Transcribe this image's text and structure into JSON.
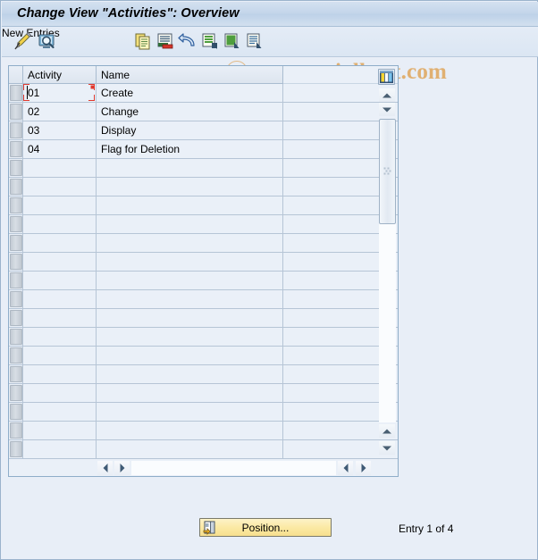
{
  "window": {
    "title": "Change View \"Activities\": Overview"
  },
  "toolbar": {
    "new_entries_label": "New Entries",
    "icons": [
      {
        "name": "change-pencil-icon",
        "title": "Change"
      },
      {
        "name": "display-magnifier-icon",
        "title": "Display"
      },
      {
        "name": "copy-as-icon",
        "title": "Copy As..."
      },
      {
        "name": "delete-entry-icon",
        "title": "Delete"
      },
      {
        "name": "undo-change-icon",
        "title": "Undo Change"
      },
      {
        "name": "select-all-icon",
        "title": "Select All"
      },
      {
        "name": "deselect-all-icon",
        "title": "Deselect All"
      },
      {
        "name": "details-icon",
        "title": "Details"
      }
    ]
  },
  "watermark": {
    "text": "www.tutorialkart.com"
  },
  "table": {
    "columns": [
      {
        "key": "activity",
        "label": "Activity"
      },
      {
        "key": "name",
        "label": "Name"
      }
    ],
    "rows": [
      {
        "activity": "01",
        "name": "Create"
      },
      {
        "activity": "02",
        "name": "Change"
      },
      {
        "activity": "03",
        "name": "Display"
      },
      {
        "activity": "04",
        "name": "Flag for Deletion"
      }
    ],
    "empty_row_count": 16,
    "focused_cell": {
      "row": 0,
      "column": "activity"
    },
    "column_config_icon": "column-configuration-icon"
  },
  "scrollbars": {
    "vertical": {
      "up_icon": "scroll-up-icon",
      "down_icon": "scroll-down-icon",
      "page_up_icon": "scroll-page-up-icon",
      "page_down_icon": "scroll-page-down-icon",
      "thumb_grip_icon": "scrollbar-grip-icon"
    },
    "horizontal": {
      "left_icon": "scroll-left-icon",
      "right_icon": "scroll-right-icon",
      "page_left_icon": "scroll-page-left-icon",
      "page_right_icon": "scroll-page-right-icon"
    }
  },
  "footer": {
    "position_button_label": "Position...",
    "position_button_icon": "position-icon",
    "entry_status": "Entry 1 of 4"
  },
  "colors": {
    "title_bar": "#c3d5ea",
    "window_bg": "#e8eef7",
    "table_bg": "#eaf0f8",
    "grid_line": "#b6c5d6",
    "focus_marker": "#e03a2f",
    "button_yellow": "#fbe9a4",
    "watermark": "#e0a860"
  }
}
